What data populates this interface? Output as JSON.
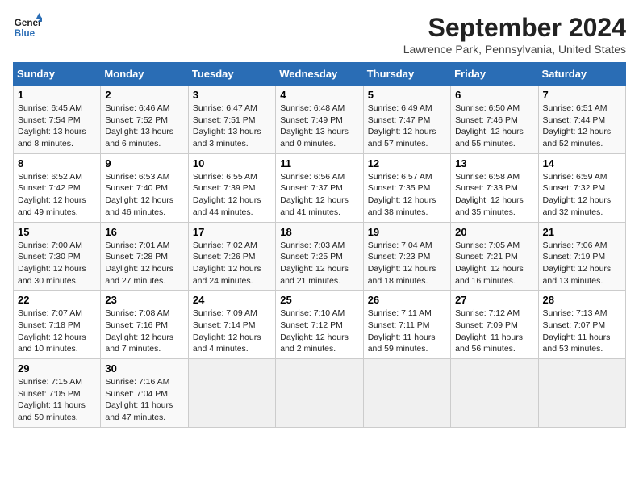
{
  "header": {
    "logo_line1": "General",
    "logo_line2": "Blue",
    "month_title": "September 2024",
    "location": "Lawrence Park, Pennsylvania, United States"
  },
  "days_of_week": [
    "Sunday",
    "Monday",
    "Tuesday",
    "Wednesday",
    "Thursday",
    "Friday",
    "Saturday"
  ],
  "weeks": [
    [
      {
        "day": "1",
        "sunrise": "6:45 AM",
        "sunset": "7:54 PM",
        "daylight": "13 hours and 8 minutes."
      },
      {
        "day": "2",
        "sunrise": "6:46 AM",
        "sunset": "7:52 PM",
        "daylight": "13 hours and 6 minutes."
      },
      {
        "day": "3",
        "sunrise": "6:47 AM",
        "sunset": "7:51 PM",
        "daylight": "13 hours and 3 minutes."
      },
      {
        "day": "4",
        "sunrise": "6:48 AM",
        "sunset": "7:49 PM",
        "daylight": "13 hours and 0 minutes."
      },
      {
        "day": "5",
        "sunrise": "6:49 AM",
        "sunset": "7:47 PM",
        "daylight": "12 hours and 57 minutes."
      },
      {
        "day": "6",
        "sunrise": "6:50 AM",
        "sunset": "7:46 PM",
        "daylight": "12 hours and 55 minutes."
      },
      {
        "day": "7",
        "sunrise": "6:51 AM",
        "sunset": "7:44 PM",
        "daylight": "12 hours and 52 minutes."
      }
    ],
    [
      {
        "day": "8",
        "sunrise": "6:52 AM",
        "sunset": "7:42 PM",
        "daylight": "12 hours and 49 minutes."
      },
      {
        "day": "9",
        "sunrise": "6:53 AM",
        "sunset": "7:40 PM",
        "daylight": "12 hours and 46 minutes."
      },
      {
        "day": "10",
        "sunrise": "6:55 AM",
        "sunset": "7:39 PM",
        "daylight": "12 hours and 44 minutes."
      },
      {
        "day": "11",
        "sunrise": "6:56 AM",
        "sunset": "7:37 PM",
        "daylight": "12 hours and 41 minutes."
      },
      {
        "day": "12",
        "sunrise": "6:57 AM",
        "sunset": "7:35 PM",
        "daylight": "12 hours and 38 minutes."
      },
      {
        "day": "13",
        "sunrise": "6:58 AM",
        "sunset": "7:33 PM",
        "daylight": "12 hours and 35 minutes."
      },
      {
        "day": "14",
        "sunrise": "6:59 AM",
        "sunset": "7:32 PM",
        "daylight": "12 hours and 32 minutes."
      }
    ],
    [
      {
        "day": "15",
        "sunrise": "7:00 AM",
        "sunset": "7:30 PM",
        "daylight": "12 hours and 30 minutes."
      },
      {
        "day": "16",
        "sunrise": "7:01 AM",
        "sunset": "7:28 PM",
        "daylight": "12 hours and 27 minutes."
      },
      {
        "day": "17",
        "sunrise": "7:02 AM",
        "sunset": "7:26 PM",
        "daylight": "12 hours and 24 minutes."
      },
      {
        "day": "18",
        "sunrise": "7:03 AM",
        "sunset": "7:25 PM",
        "daylight": "12 hours and 21 minutes."
      },
      {
        "day": "19",
        "sunrise": "7:04 AM",
        "sunset": "7:23 PM",
        "daylight": "12 hours and 18 minutes."
      },
      {
        "day": "20",
        "sunrise": "7:05 AM",
        "sunset": "7:21 PM",
        "daylight": "12 hours and 16 minutes."
      },
      {
        "day": "21",
        "sunrise": "7:06 AM",
        "sunset": "7:19 PM",
        "daylight": "12 hours and 13 minutes."
      }
    ],
    [
      {
        "day": "22",
        "sunrise": "7:07 AM",
        "sunset": "7:18 PM",
        "daylight": "12 hours and 10 minutes."
      },
      {
        "day": "23",
        "sunrise": "7:08 AM",
        "sunset": "7:16 PM",
        "daylight": "12 hours and 7 minutes."
      },
      {
        "day": "24",
        "sunrise": "7:09 AM",
        "sunset": "7:14 PM",
        "daylight": "12 hours and 4 minutes."
      },
      {
        "day": "25",
        "sunrise": "7:10 AM",
        "sunset": "7:12 PM",
        "daylight": "12 hours and 2 minutes."
      },
      {
        "day": "26",
        "sunrise": "7:11 AM",
        "sunset": "7:11 PM",
        "daylight": "11 hours and 59 minutes."
      },
      {
        "day": "27",
        "sunrise": "7:12 AM",
        "sunset": "7:09 PM",
        "daylight": "11 hours and 56 minutes."
      },
      {
        "day": "28",
        "sunrise": "7:13 AM",
        "sunset": "7:07 PM",
        "daylight": "11 hours and 53 minutes."
      }
    ],
    [
      {
        "day": "29",
        "sunrise": "7:15 AM",
        "sunset": "7:05 PM",
        "daylight": "11 hours and 50 minutes."
      },
      {
        "day": "30",
        "sunrise": "7:16 AM",
        "sunset": "7:04 PM",
        "daylight": "11 hours and 47 minutes."
      },
      null,
      null,
      null,
      null,
      null
    ]
  ],
  "labels": {
    "sunrise_prefix": "Sunrise: ",
    "sunset_prefix": "Sunset: ",
    "daylight_prefix": "Daylight: "
  }
}
